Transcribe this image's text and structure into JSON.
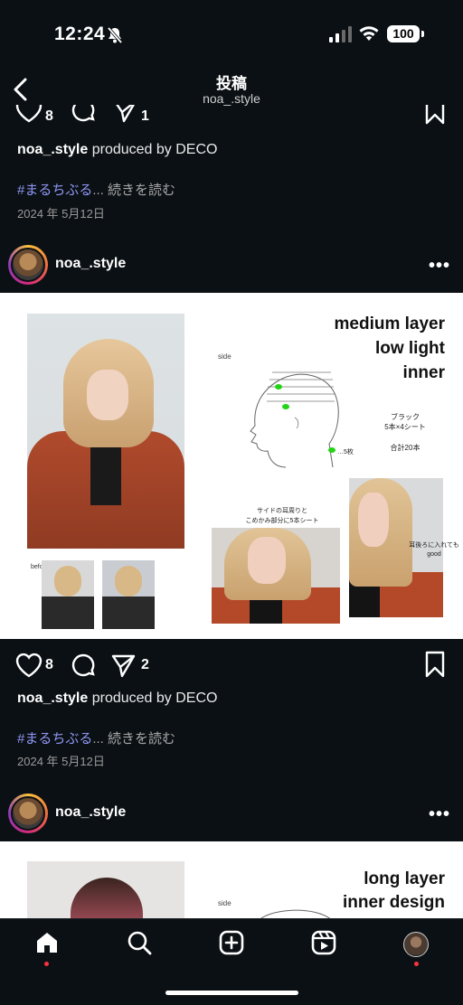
{
  "status_bar": {
    "time": "12:24",
    "battery": "100"
  },
  "header": {
    "title": "投稿",
    "subtitle": "noa_.style"
  },
  "post_prev": {
    "likes": "8",
    "shares": "1",
    "caption_user": "noa_.style",
    "caption_text": " produced by DECO",
    "hashtag": "#まるちぶる",
    "more": "... 続きを読む",
    "date": "2024 年 5月12日"
  },
  "post1": {
    "username": "noa_.style",
    "likes": "8",
    "shares": "2",
    "caption_user": "noa_.style",
    "caption_text": " produced by DECO",
    "hashtag": "#まるちぶる",
    "more": "... 続きを読む",
    "date": "2024 年 5月12日",
    "image": {
      "heading": [
        "medium layer",
        "low light",
        "inner"
      ],
      "side_label": "side",
      "before_label": "before",
      "legend_color": "ブラック",
      "legend_count": "5本×4シート",
      "legend_total": "合計20本",
      "dot_label": "…5枚",
      "note_left": [
        "サイドの耳周りと",
        "こめかみ部分に5本シート"
      ],
      "note_right": [
        "耳後ろに入れても",
        "good"
      ],
      "highlight_color": "#22d414"
    }
  },
  "post2": {
    "username": "noa_.style",
    "image": {
      "heading": [
        "long layer",
        "inner design"
      ],
      "side_label": "side"
    }
  },
  "icons": [
    "back-icon",
    "heart-icon",
    "comment-icon",
    "share-icon",
    "bookmark-icon",
    "more-icon",
    "home-icon",
    "search-icon",
    "create-icon",
    "reels-icon",
    "profile-icon"
  ]
}
